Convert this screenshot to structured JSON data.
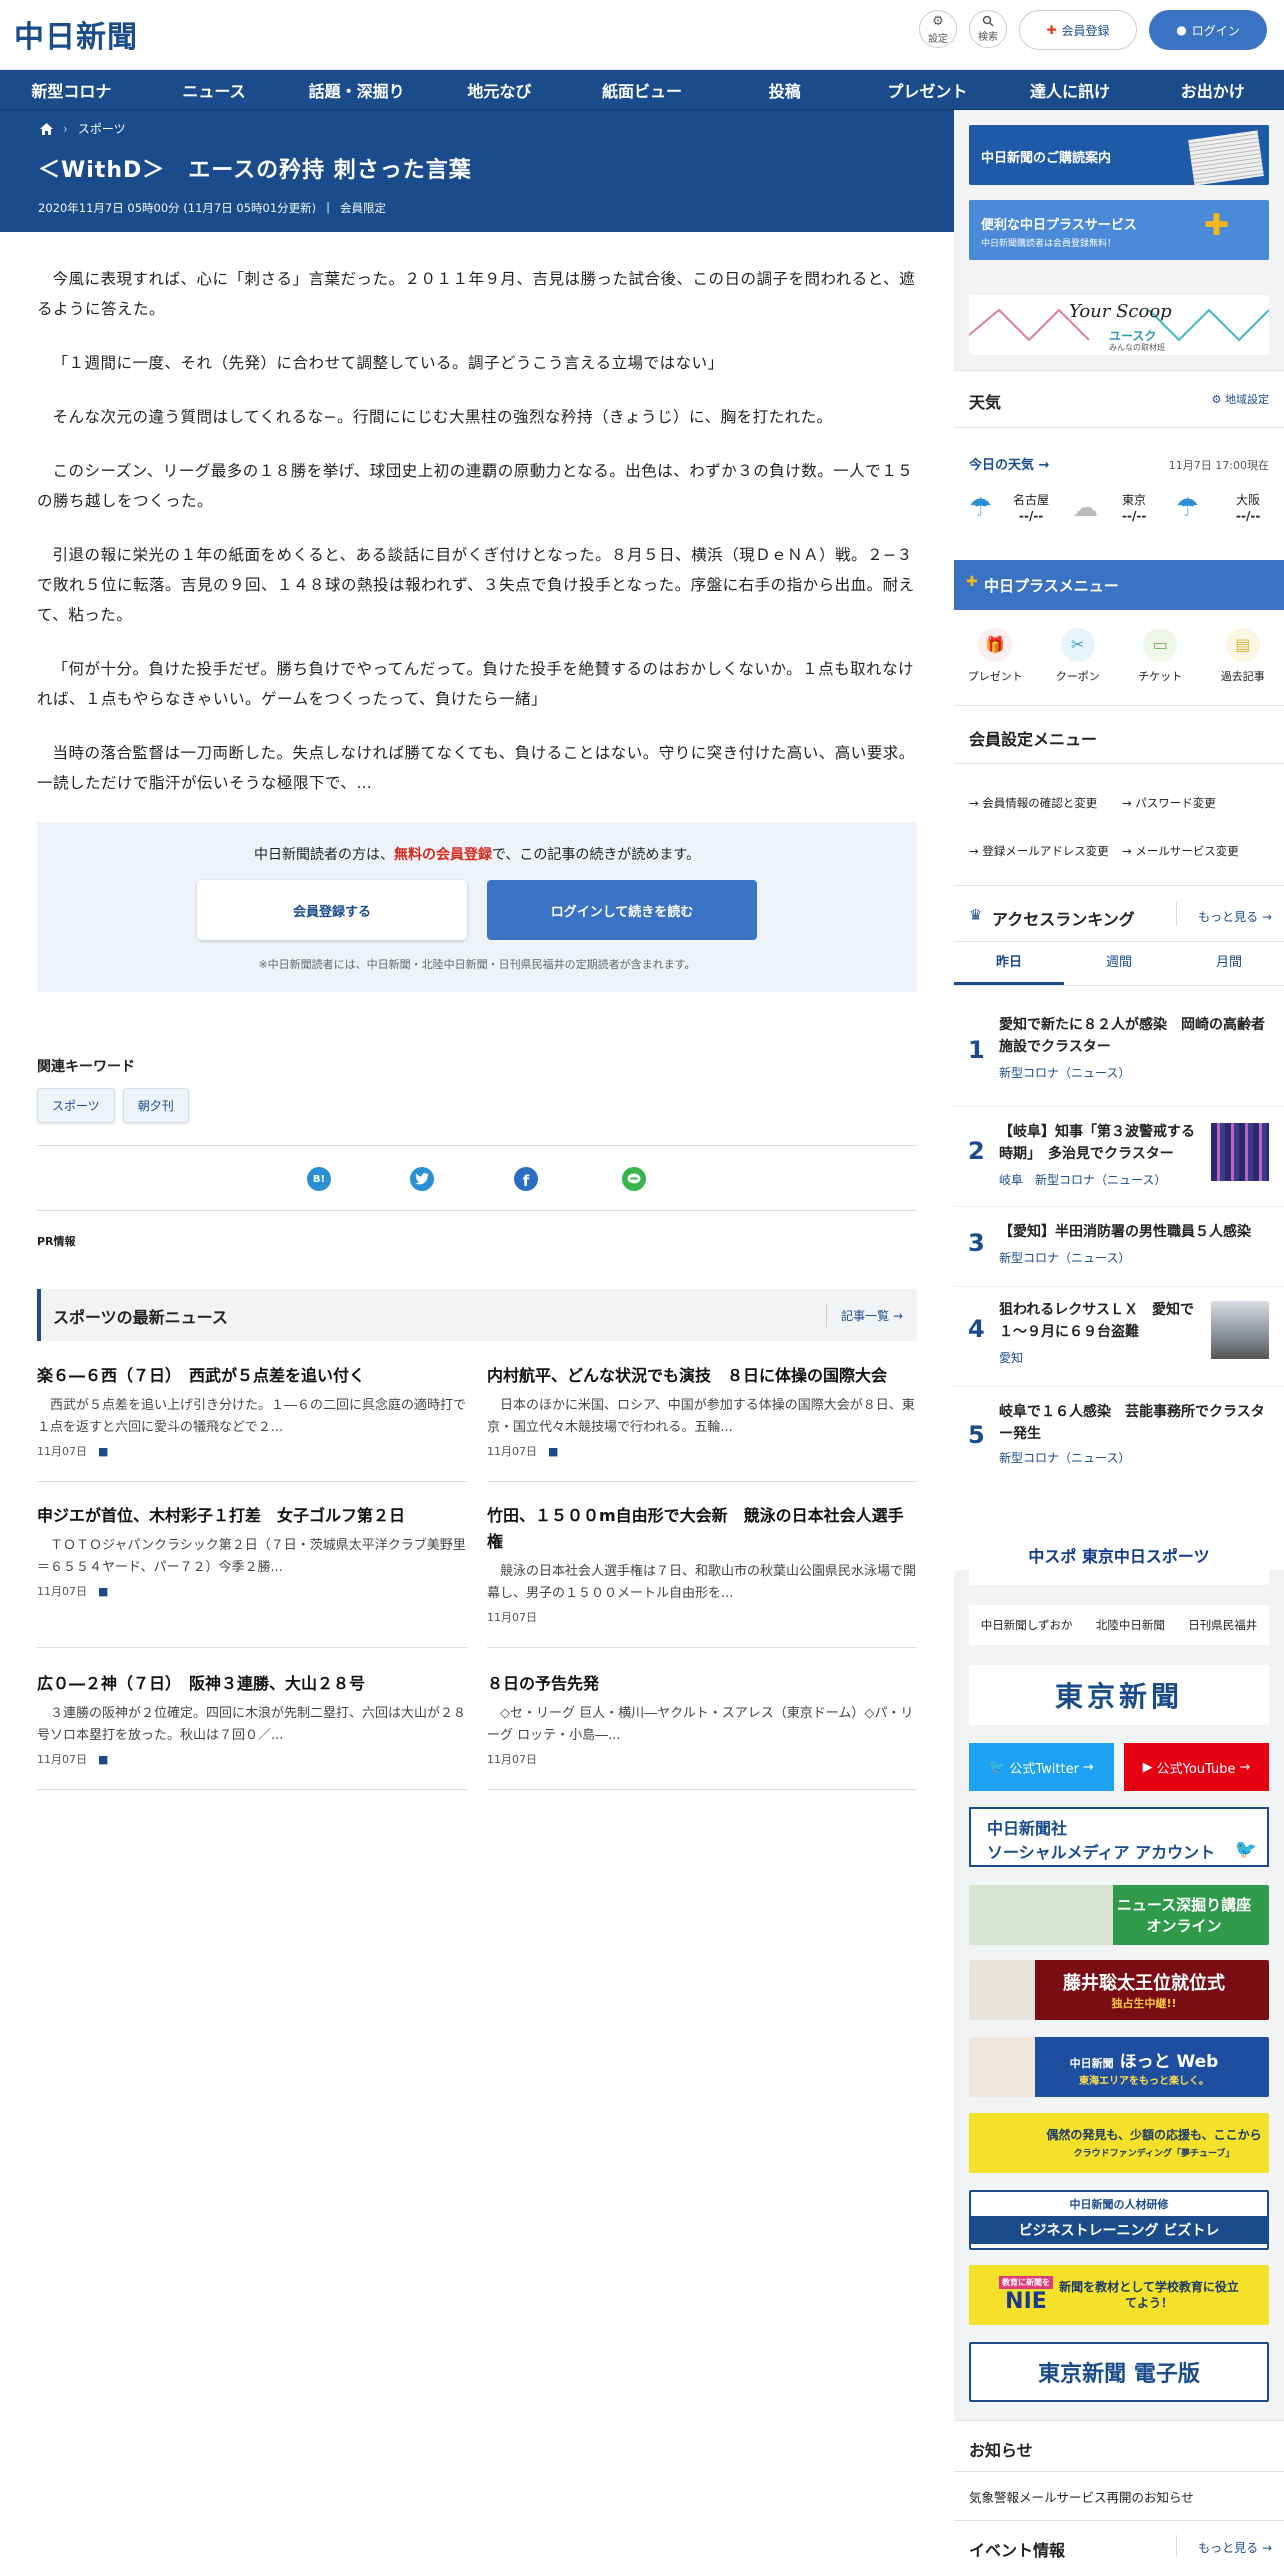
{
  "header": {
    "logo": "中日新聞",
    "settings_label": "設定",
    "search_label": "検索",
    "register_label": "会員登録",
    "login_label": "ログイン"
  },
  "nav": [
    "新型コロナ",
    "ニュース",
    "話題・深掘り",
    "地元なび",
    "紙面ビュー",
    "投稿",
    "プレゼント",
    "達人に訊け",
    "お出かけ"
  ],
  "breadcrumb": {
    "category": "スポーツ"
  },
  "article": {
    "title": "＜WithD＞　エースの矜持 刺さった言葉",
    "meta": "2020年11月7日 05時00分 (11月7日 05時01分更新)",
    "badge": "会員限定",
    "paragraphs": [
      "今風に表現すれば、心に「刺さる」言葉だった。２０１１年９月、吉見は勝った試合後、この日の調子を問われると、遮るように答えた。",
      "「１週間に一度、それ（先発）に合わせて調整している。調子どうこう言える立場ではない」",
      "そんな次元の違う質問はしてくれるな−。行間ににじむ大黒柱の強烈な矜持（きょうじ）に、胸を打たれた。",
      "このシーズン、リーグ最多の１８勝を挙げ、球団史上初の連覇の原動力となる。出色は、わずか３の負け数。一人で１５の勝ち越しをつくった。",
      "引退の報に栄光の１年の紙面をめくると、ある談話に目がくぎ付けとなった。８月５日、横浜（現ＤｅＮＡ）戦。２−３で敗れ５位に転落。吉見の９回、１４８球の熱投は報われず、３失点で負け投手となった。序盤に右手の指から出血。耐えて、粘った。",
      "「何が十分。負けた投手だぜ。勝ち負けでやってんだって。負けた投手を絶賛するのはおかしくないか。１点も取れなければ、１点もやらなきゃいい。ゲームをつくったって、負けたら一緒」",
      "当時の落合監督は一刀両断した。失点しなければ勝てなくても、負けることはない。守りに突き付けた高い、高い要求。一読しただけで脂汗が伝いそうな極限下で、…"
    ]
  },
  "paywall": {
    "text_pre": "中日新聞読者の方は、",
    "text_link": "無料の会員登録",
    "text_post": "で、この記事の続きが読めます。",
    "register_button": "会員登録する",
    "login_button": "ログインして続きを読む",
    "note": "※中日新聞読者には、中日新聞・北陸中日新聞・日刊県民福井の定期読者が含まれます。"
  },
  "keywords": {
    "heading": "関連キーワード",
    "tags": [
      "スポーツ",
      "朝夕刊"
    ]
  },
  "share": {
    "hatena": "B!"
  },
  "pr": {
    "heading": "PR情報"
  },
  "latest": {
    "heading": "スポーツの最新ニュース",
    "more": "記事一覧",
    "items": [
      {
        "title": "楽６―６西（７日）　西武が５点差を追い付く",
        "desc": "西武が５点差を追い上げ引き分けた。１―６の二回に呉念庭の適時打で１点を返すと六回に愛斗の犠飛などで２...",
        "date": "11月07日",
        "camera": true
      },
      {
        "title": "内村航平、どんな状況でも演技　８日に体操の国際大会",
        "desc": "日本のほかに米国、ロシア、中国が参加する体操の国際大会が８日、東京・国立代々木競技場で行われる。五輪...",
        "date": "11月07日",
        "camera": true
      },
      {
        "title": "申ジエが首位、木村彩子１打差　女子ゴルフ第２日",
        "desc": "ＴＯＴＯジャパンクラシック第２日（７日・茨城県太平洋クラブ美野里＝６５５４ヤード、パー７２）今季２勝...",
        "date": "11月07日",
        "camera": true
      },
      {
        "title": "竹田、１５００m自由形で大会新　競泳の日本社会人選手権",
        "desc": "競泳の日本社会人選手権は７日、和歌山市の秋葉山公園県民水泳場で開幕し、男子の１５００メートル自由形を...",
        "date": "11月07日",
        "camera": false
      },
      {
        "title": "広０―２神（７日）　阪神３連勝、大山２８号",
        "desc": "３連勝の阪神が２位確定。四回に木浪が先制二塁打、六回は大山が２８号ソロ本塁打を放った。秋山は７回０／...",
        "date": "11月07日",
        "camera": true
      },
      {
        "title": "８日の予告先発",
        "desc": "◇セ・リーグ 巨人・横川―ヤクルト・スアレス（東京ドーム）◇パ・リーグ ロッテ・小島―...",
        "date": "11月07日",
        "camera": false
      }
    ]
  },
  "sidebar": {
    "banner1": "中日新聞のご購読案内",
    "banner2_title": "便利な中日プラスサービス",
    "banner2_sub": "中日新聞購読者は会員登録無料！",
    "banner3_title": "Your Scoop",
    "banner3_sub": "ユースク",
    "banner3_tag": "みんなの取材班",
    "weather": {
      "heading": "天気",
      "settings": "地域設定",
      "today": "今日の天気",
      "time": "11月7日 17:00現在",
      "cities": [
        {
          "name": "名古屋",
          "value": "--/--",
          "icon": "umbrella"
        },
        {
          "name": "東京",
          "value": "--/--",
          "icon": "cloud"
        },
        {
          "name": "大阪",
          "value": "--/--",
          "icon": "umbrella"
        }
      ]
    },
    "plus_menu": {
      "heading": "中日プラスメニュー",
      "items": [
        "プレゼント",
        "クーポン",
        "チケット",
        "過去記事"
      ]
    },
    "member_menu": {
      "heading": "会員設定メニュー",
      "items": [
        "会員情報の確認と変更",
        "パスワード変更",
        "登録メールアドレス変更",
        "メールサービス変更"
      ]
    },
    "ranking": {
      "heading": "アクセスランキング",
      "more": "もっと見る",
      "tabs": [
        "昨日",
        "週間",
        "月間"
      ],
      "items": [
        {
          "rank": "1",
          "title": "愛知で新たに８２人が感染　岡崎の高齢者施設でクラスター",
          "cat": "新型コロナ（ニュース）",
          "thumb": false
        },
        {
          "rank": "2",
          "title": "【岐阜】知事「第３波警戒する時期」　多治見でクラスター",
          "cat": "岐阜　新型コロナ（ニュース）",
          "thumb": true
        },
        {
          "rank": "3",
          "title": "【愛知】半田消防署の男性職員５人感染",
          "cat": "新型コロナ（ニュース）",
          "thumb": false
        },
        {
          "rank": "4",
          "title": "狙われるレクサスＬＸ　愛知で１〜９月に６９台盗難",
          "cat": "愛知",
          "thumb": true
        },
        {
          "rank": "5",
          "title": "岐阜で１６人感染　芸能事務所でクラスター発生",
          "cat": "新型コロナ（ニュース）",
          "thumb": false
        }
      ]
    },
    "chuspo": "中スポ 東京中日スポーツ",
    "links": [
      "中日新聞しずおか",
      "北陸中日新聞",
      "日刊県民福井"
    ],
    "tokyo": "東京新聞",
    "twitter": "公式Twitter",
    "youtube": "公式YouTube",
    "social_line1": "中日新聞社",
    "social_line2": "ソーシャルメディア アカウント",
    "b_fukabori": "ニュース深掘り講座 オンライン",
    "b_fujii": "藤井聡太王位就位式",
    "b_fujii_sub": "独占生中継!!",
    "b_hotto_pre": "中日新聞",
    "b_hotto": "ほっと Web",
    "b_hotto_sub": "東海エリアをもっと楽しく。",
    "b_yume": "偶然の発見も、少額の応援も、ここから",
    "b_yume_sub": "クラウドファンディング「夢チューブ」",
    "b_bizutore_pre": "中日新聞の人材研修",
    "b_bizutore": "ビジネストレーニング ビズトレ",
    "b_nie_pre": "教育に新聞を",
    "b_nie": "NIE",
    "b_nie_text": "新聞を教材として学校教育に役立てよう！",
    "b_tokyo_e": "東京新聞 電子版",
    "notice": {
      "heading": "お知らせ",
      "item": "気象警報メールサービス再開のお知らせ"
    },
    "events": {
      "heading": "イベント情報",
      "more": "もっと見る"
    }
  },
  "colors": {
    "brand": "#1a4c8c",
    "accent_red": "#e8341c",
    "twitter": "#1da1f2",
    "youtube": "#e60012"
  }
}
